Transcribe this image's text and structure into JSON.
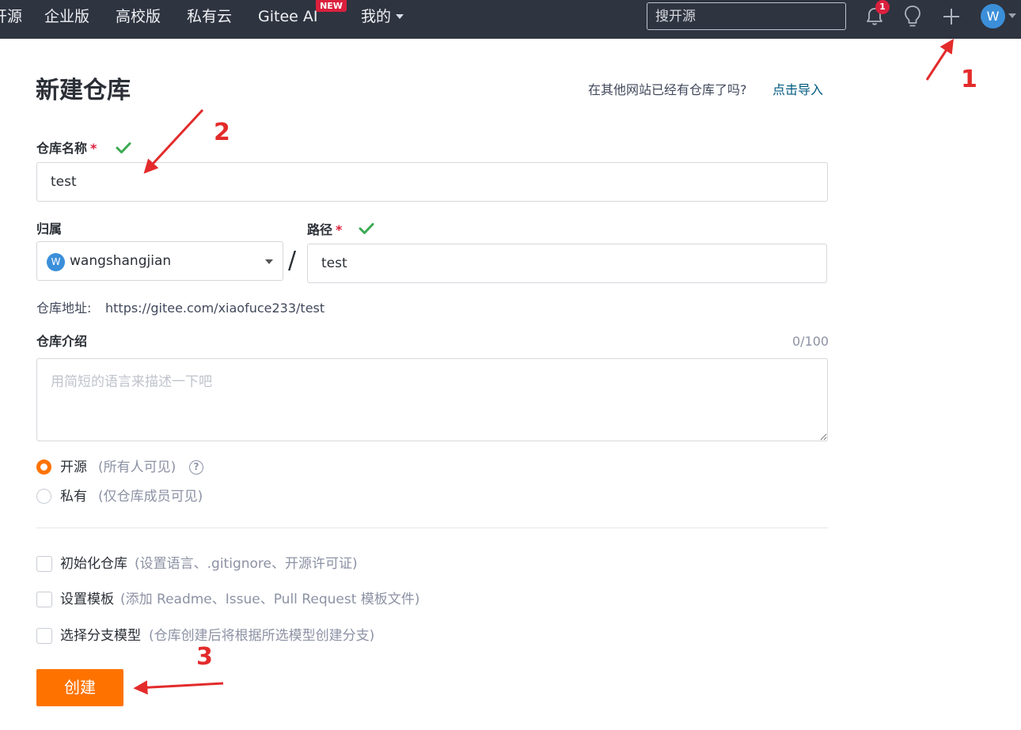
{
  "nav": {
    "items": [
      "开源",
      "企业版",
      "高校版",
      "私有云",
      "Gitee AI",
      "我的"
    ],
    "new_badge": "NEW",
    "search_placeholder": "搜开源",
    "notification_count": "1",
    "avatar_letter": "W",
    "icons": [
      "bell-icon",
      "lightbulb-icon",
      "plus-icon"
    ]
  },
  "page": {
    "title": "新建仓库",
    "import_hint": "在其他网站已经有仓库了吗?",
    "import_link": "点击导入"
  },
  "form": {
    "name_label": "仓库名称",
    "required_mark": "*",
    "name_value": "test",
    "owner_label": "归属",
    "owner_avatar_letter": "W",
    "owner_name": "wangshangjian",
    "slash": "/",
    "path_label": "路径",
    "path_value": "test",
    "repo_url_label": "仓库地址:",
    "repo_url": "https://gitee.com/xiaofuce233/test",
    "intro_label": "仓库介绍",
    "intro_counter": "0/100",
    "intro_placeholder": "用简短的语言来描述一下吧",
    "visibility": [
      {
        "label": "开源",
        "hint": "(所有人可见)",
        "selected": true
      },
      {
        "label": "私有",
        "hint": "(仅仓库成员可见)",
        "selected": false
      }
    ],
    "options": [
      {
        "label": "初始化仓库",
        "hint": "(设置语言、.gitignore、开源许可证)",
        "checked": false
      },
      {
        "label": "设置模板",
        "hint": "(添加 Readme、Issue、Pull Request 模板文件)",
        "checked": false
      },
      {
        "label": "选择分支模型",
        "hint": "(仓库创建后将根据所选模型创建分支)",
        "checked": false
      }
    ],
    "submit_label": "创建"
  },
  "annotations": [
    "1",
    "2",
    "3"
  ],
  "colors": {
    "nav_bg": "#2e3440",
    "accent_orange": "#fe7300",
    "link_blue": "#005980",
    "success_green": "#3caa52",
    "annotation_red": "#e32b2b"
  }
}
